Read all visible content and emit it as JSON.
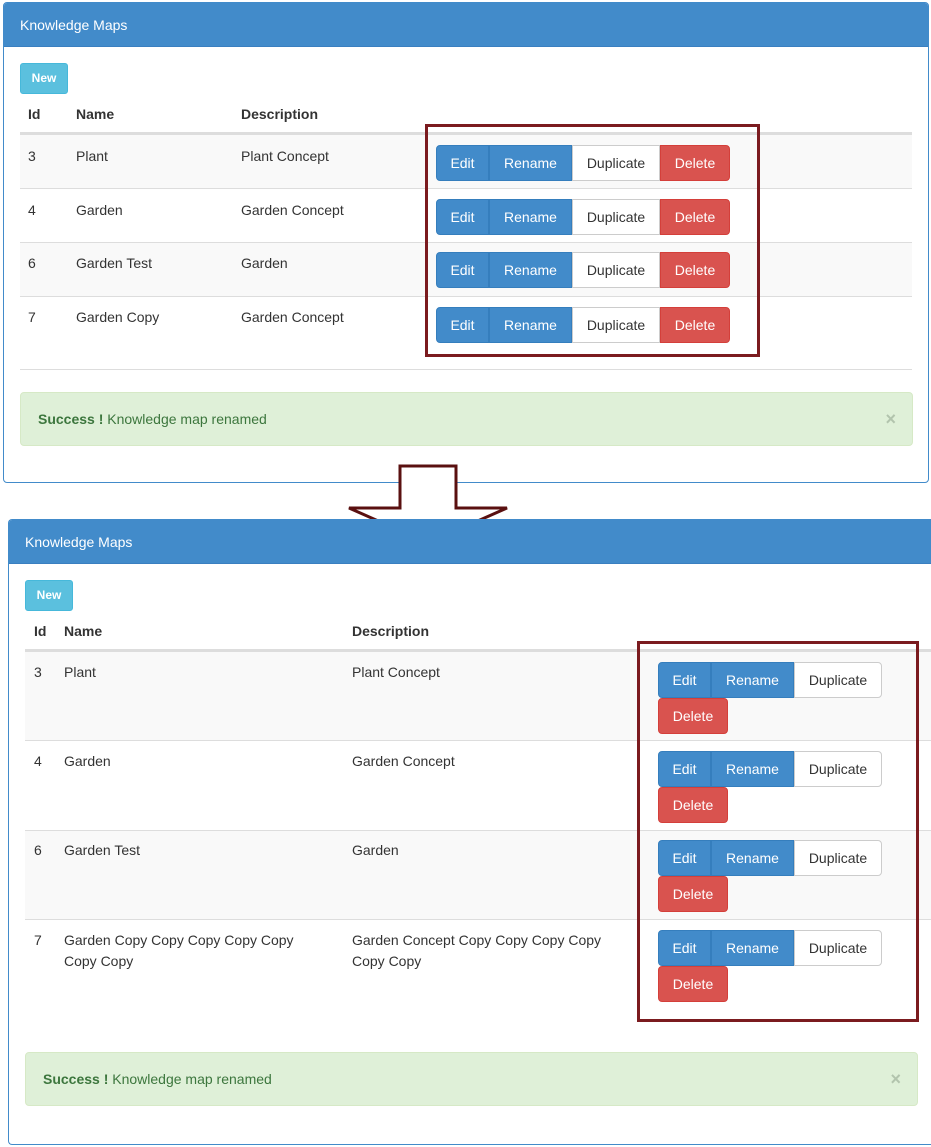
{
  "panel_title": "Knowledge Maps",
  "new_label": "New",
  "columns": {
    "id": "Id",
    "name": "Name",
    "description": "Description"
  },
  "buttons": {
    "edit": "Edit",
    "rename": "Rename",
    "duplicate": "Duplicate",
    "delete": "Delete"
  },
  "alert": {
    "strong": "Success !",
    "message": " Knowledge map renamed",
    "close": "×"
  },
  "before": {
    "rows": [
      {
        "id": "3",
        "name": "Plant",
        "description": "Plant Concept"
      },
      {
        "id": "4",
        "name": "Garden",
        "description": "Garden Concept"
      },
      {
        "id": "6",
        "name": "Garden Test",
        "description": "Garden"
      },
      {
        "id": "7",
        "name": "Garden Copy",
        "description": "Garden Concept"
      }
    ]
  },
  "after": {
    "rows": [
      {
        "id": "3",
        "name": "Plant",
        "description": "Plant Concept"
      },
      {
        "id": "4",
        "name": "Garden",
        "description": "Garden Concept"
      },
      {
        "id": "6",
        "name": "Garden Test",
        "description": "Garden"
      },
      {
        "id": "7",
        "name_line1": "Garden Copy Copy Copy Copy Copy",
        "name_line2": "Copy Copy",
        "desc_line1": "Garden Concept Copy Copy Copy Copy",
        "desc_line2": "Copy Copy"
      }
    ]
  },
  "colors": {
    "primary": "#428bca",
    "info": "#5bc0de",
    "danger": "#d9534f",
    "success_bg": "#dff0d8",
    "highlight": "#7b1b1f"
  }
}
